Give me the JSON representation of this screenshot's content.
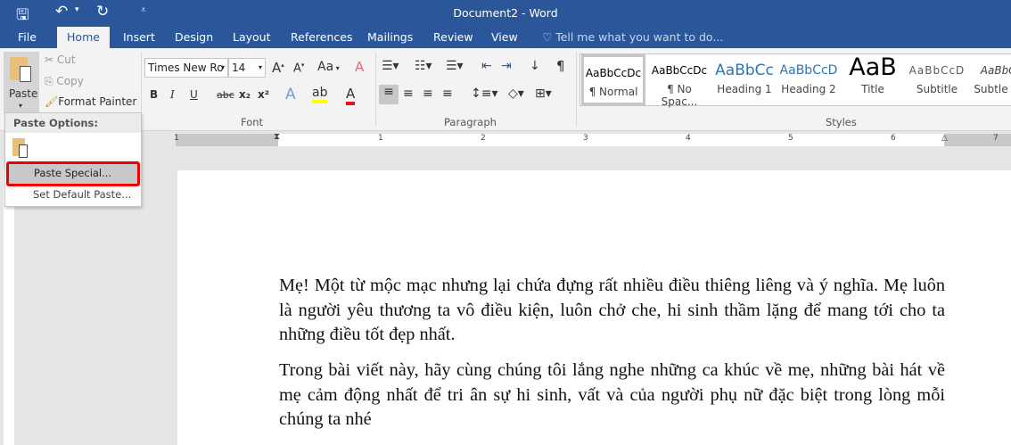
{
  "title": "Document2 - Word",
  "qat": {
    "save": "save-icon",
    "undo": "undo-icon",
    "redo": "redo-icon",
    "customize": "customize-icon"
  },
  "tabs": [
    "File",
    "Home",
    "Insert",
    "Design",
    "Layout",
    "References",
    "Mailings",
    "Review",
    "View"
  ],
  "tell_me": "Tell me what you want to do...",
  "clipboard": {
    "paste": "Paste",
    "cut": "Cut",
    "copy": "Copy",
    "format_painter": "Format Painter"
  },
  "font": {
    "name": "Times New Ro",
    "size": "14",
    "label": "Font",
    "case": "Aa",
    "bold": "B",
    "italic": "I",
    "underline": "U",
    "strike": "abc",
    "sub": "x₂",
    "sup": "x²",
    "color_accent": "#e81123",
    "highlight": "#ffff00"
  },
  "paragraph": {
    "label": "Paragraph",
    "pilcrow": "¶"
  },
  "styles": {
    "label": "Styles",
    "items": [
      {
        "preview": "AaBbCcDc",
        "name": "¶ Normal"
      },
      {
        "preview": "AaBbCcDc",
        "name": "¶ No Spac..."
      },
      {
        "preview": "AaBbCc",
        "name": "Heading 1"
      },
      {
        "preview": "AaBbCcD",
        "name": "Heading 2"
      },
      {
        "preview": "AaB",
        "name": "Title"
      },
      {
        "preview": "AaBbCcD",
        "name": "Subtitle"
      },
      {
        "preview": "AaBbCc",
        "name": "Subtle Em"
      }
    ]
  },
  "ruler": [
    "1",
    "1",
    "2",
    "3",
    "4",
    "5",
    "6",
    "7"
  ],
  "paste_menu": {
    "header": "Paste Options:",
    "paste_special": "Paste Special...",
    "set_default": "Set Default Paste..."
  },
  "document": {
    "paragraphs": [
      "Mẹ! Một từ mộc mạc nhưng lại chứa đựng rất nhiều điều thiêng liêng và ý nghĩa. Mẹ luôn là người yêu thương ta vô điều kiện, luôn chở che, hi sinh thầm lặng để mang tới cho ta những điều tốt đẹp nhất.",
      "Trong bài viết này, hãy cùng chúng tôi lắng nghe những ca khúc về mẹ, những bài hát về mẹ cảm động nhất để tri ân sự hi sinh, vất và của người phụ nữ đặc biệt trong lòng mỗi chúng ta nhé"
    ]
  }
}
